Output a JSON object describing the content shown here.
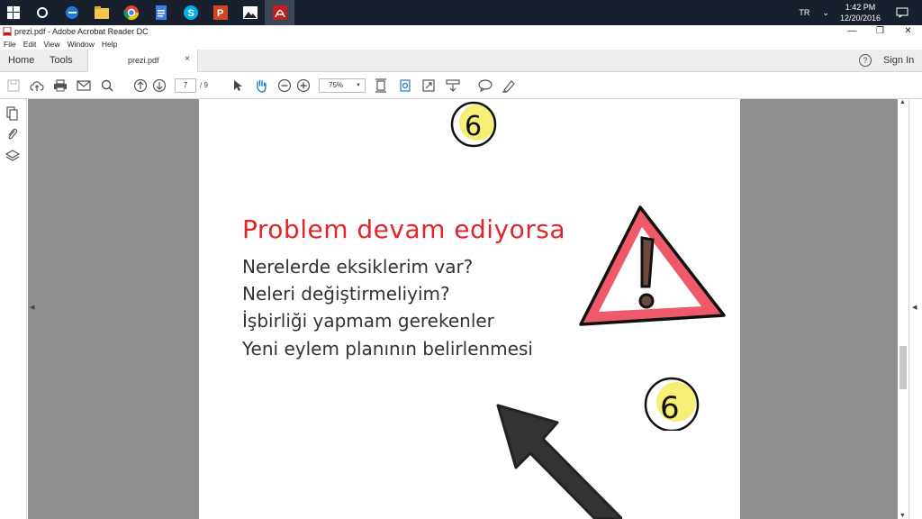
{
  "taskbar": {
    "apps": [
      "cortana-icon",
      "edge-icon",
      "file-explorer-icon",
      "chrome-icon",
      "docs-icon",
      "skype-icon",
      "powerpoint-icon",
      "photos-icon",
      "acrobat-icon"
    ],
    "language": "TR",
    "time": "1:42 PM",
    "date": "12/20/2016"
  },
  "window": {
    "title": "prezi.pdf - Adobe Acrobat Reader DC"
  },
  "menu": [
    "File",
    "Edit",
    "View",
    "Window",
    "Help"
  ],
  "tabs": {
    "home": "Home",
    "tools": "Tools",
    "document": "prezi.pdf",
    "close": "×",
    "sign_in": "Sign In",
    "help": "?"
  },
  "toolbar": {
    "page_current": "7",
    "page_total": "/ 9",
    "zoom": "75%"
  },
  "slide": {
    "title": "Problem devam ediyorsa",
    "lines": [
      "Nerelerde eksiklerim var?",
      "Neleri değiştirmeliyim?",
      "İşbirliği yapmam gerekenler",
      "Yeni eylem planının belirlenmesi"
    ],
    "badge_top": "6",
    "badge_bottom": "6"
  },
  "colors": {
    "taskbar": "#17202c",
    "title_red": "#e0262b",
    "warning_border": "#ee5a6a",
    "badge_yellow": "#f5ef78",
    "arrow": "#333333"
  }
}
